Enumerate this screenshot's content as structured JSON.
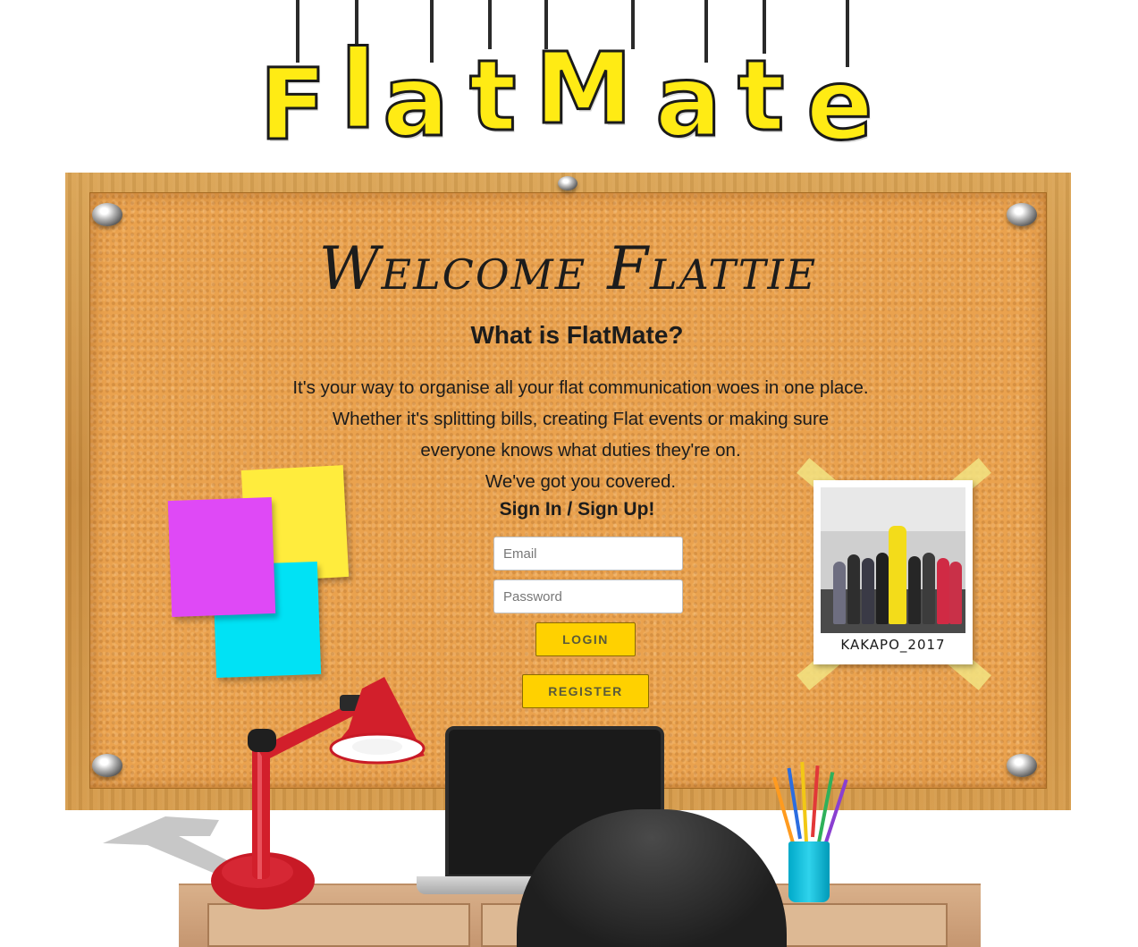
{
  "logo": {
    "text": "FlatMate",
    "letters": [
      "F",
      "l",
      "a",
      "t",
      "M",
      "a",
      "t",
      "e"
    ]
  },
  "board": {
    "welcome_title": "Welcome Flattie",
    "subtitle": "What is FlatMate?",
    "description_lines": [
      "It's your way to organise all your flat communication woes in one place.",
      "Whether it's splitting bills, creating Flat events or making sure",
      "everyone knows what duties they're on.",
      "We've got you covered."
    ],
    "signin_heading": "Sign In / Sign Up!"
  },
  "form": {
    "email_placeholder": "Email",
    "email_value": "",
    "password_placeholder": "Password",
    "password_value": "",
    "login_label": "LOGIN",
    "register_label": "REGISTER"
  },
  "polaroid": {
    "caption": "KAKAPO_2017"
  },
  "colors": {
    "logo_yellow": "#ffeb14",
    "button_yellow": "#ffd100",
    "cork": "#eaa24e",
    "frame_wood": "#d69b4a",
    "sticky_yellow": "#ffec3d",
    "sticky_pink": "#df49f6",
    "sticky_cyan": "#00e2f5",
    "lamp_red": "#d21f2b",
    "cup_cyan": "#2fd3ec"
  },
  "icons": {
    "screws": "screw-icon",
    "lamp": "desk-lamp-icon",
    "laptop": "laptop-icon",
    "chair": "office-chair-icon",
    "pencils": "pencil-cup-icon"
  }
}
